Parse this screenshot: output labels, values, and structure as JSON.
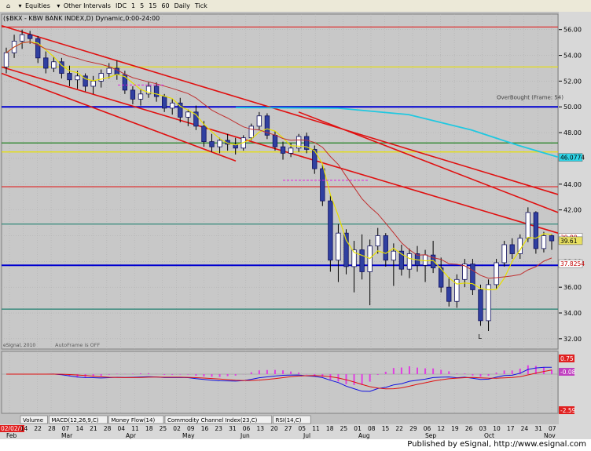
{
  "toolbar": {
    "items": [
      {
        "name": "home-icon",
        "label": ""
      },
      {
        "name": "equities-dropdown",
        "label": "Equities"
      },
      {
        "name": "other-intervals-dropdown",
        "label": "Other Intervals"
      },
      {
        "name": "idc-button",
        "label": "IDC"
      },
      {
        "name": "interval-1",
        "label": "1"
      },
      {
        "name": "interval-5",
        "label": "5"
      },
      {
        "name": "interval-15",
        "label": "15"
      },
      {
        "name": "interval-60",
        "label": "60"
      },
      {
        "name": "daily-button",
        "label": "Daily"
      },
      {
        "name": "tick-button",
        "label": "Tick"
      }
    ]
  },
  "chart_data": {
    "type": "candlestick",
    "title": "($BKX - KBW BANK INDEX,D) Dynamic,0:00-24:00",
    "ylim": [
      31.2,
      57.2
    ],
    "y_ticks": [
      "56.00",
      "54.00",
      "52.00",
      "50.00",
      "48.00",
      "46.00",
      "44.00",
      "42.00",
      "40.00",
      "38.00",
      "36.00",
      "34.00",
      "32.00"
    ],
    "x_ticks": [
      "02/02/11",
      "14",
      "22",
      "28",
      "07",
      "14",
      "21",
      "28",
      "04",
      "11",
      "18",
      "25",
      "02",
      "09",
      "16",
      "23",
      "31",
      "06",
      "13",
      "20",
      "27",
      "05",
      "11",
      "18",
      "25",
      "01",
      "08",
      "15",
      "22",
      "29",
      "06",
      "12",
      "19",
      "26",
      "03",
      "10",
      "17",
      "24",
      "31",
      "07"
    ],
    "month_labels": [
      "Feb",
      "Mar",
      "Apr",
      "May",
      "Jun",
      "Jul",
      "Aug",
      "Sep",
      "Oct",
      "Nov"
    ],
    "price_labels": [
      {
        "text": "56.00"
      },
      {
        "text": "54.00"
      },
      {
        "text": "52.00"
      },
      {
        "text": "50.00"
      },
      {
        "text": "48.00"
      },
      {
        "text": "46.00"
      },
      {
        "text": "44.00"
      },
      {
        "text": "42.00"
      },
      {
        "text": "40.00"
      },
      {
        "text": "38.00"
      },
      {
        "text": "36.00"
      },
      {
        "text": "34.00"
      },
      {
        "text": "32.00"
      }
    ],
    "value_badges": [
      {
        "text": "46.0774",
        "value": 46.08,
        "color": "#2fd6e8"
      },
      {
        "text": "39.88",
        "value": 39.88,
        "color": "#ffffff"
      },
      {
        "text": "39.61",
        "value": 39.61,
        "color": "#e8e060"
      },
      {
        "text": "37.8254",
        "value": 37.83,
        "color": "#ffffff"
      }
    ],
    "horizontal_lines": [
      {
        "value": 56.2,
        "color": "#e02020"
      },
      {
        "value": 53.1,
        "color": "#e8e000"
      },
      {
        "value": 50.0,
        "color": "#0000d0"
      },
      {
        "value": 47.2,
        "color": "#208020"
      },
      {
        "value": 46.5,
        "color": "#e8e000"
      },
      {
        "value": 43.8,
        "color": "#e02020"
      },
      {
        "value": 40.9,
        "color": "#208070"
      },
      {
        "value": 37.7,
        "color": "#0000d0"
      },
      {
        "value": 34.3,
        "color": "#208070"
      }
    ],
    "annotations": {
      "overbought": "OverBought (Frame: 54)",
      "autoframe": "AutoFrame is OFF",
      "esignal": "eSignal, 2010",
      "low_marker": "L"
    },
    "candles": [
      [
        53.1,
        54.6,
        52.6,
        54.2
      ],
      [
        54.2,
        55.6,
        53.8,
        55.1
      ],
      [
        55.1,
        56.0,
        54.5,
        55.6
      ],
      [
        55.6,
        55.9,
        54.9,
        55.3
      ],
      [
        55.3,
        55.5,
        53.4,
        53.8
      ],
      [
        53.8,
        54.3,
        52.6,
        53.0
      ],
      [
        53.0,
        53.9,
        52.7,
        53.5
      ],
      [
        53.5,
        53.8,
        52.2,
        52.6
      ],
      [
        52.6,
        53.2,
        51.6,
        52.1
      ],
      [
        52.1,
        52.8,
        51.4,
        52.4
      ],
      [
        52.4,
        52.6,
        51.2,
        51.6
      ],
      [
        51.6,
        52.4,
        51.0,
        52.0
      ],
      [
        52.0,
        52.9,
        51.5,
        52.6
      ],
      [
        52.6,
        53.4,
        52.2,
        53.0
      ],
      [
        53.0,
        53.6,
        52.1,
        52.5
      ],
      [
        52.5,
        52.8,
        51.0,
        51.3
      ],
      [
        51.3,
        51.6,
        50.2,
        50.6
      ],
      [
        50.6,
        51.4,
        50.1,
        51.0
      ],
      [
        51.0,
        51.9,
        50.7,
        51.6
      ],
      [
        51.6,
        51.9,
        50.4,
        50.8
      ],
      [
        50.8,
        51.0,
        49.6,
        49.9
      ],
      [
        49.9,
        50.6,
        49.4,
        50.3
      ],
      [
        50.3,
        50.7,
        48.8,
        49.2
      ],
      [
        49.2,
        49.8,
        48.5,
        49.6
      ],
      [
        49.6,
        50.1,
        48.2,
        48.5
      ],
      [
        48.5,
        48.9,
        46.9,
        47.3
      ],
      [
        47.3,
        47.9,
        46.5,
        46.9
      ],
      [
        46.9,
        47.6,
        46.4,
        47.4
      ],
      [
        47.4,
        47.9,
        46.6,
        47.1
      ],
      [
        47.1,
        47.6,
        46.3,
        46.8
      ],
      [
        46.8,
        47.8,
        46.6,
        47.6
      ],
      [
        47.6,
        48.7,
        47.4,
        48.5
      ],
      [
        48.5,
        49.6,
        48.2,
        49.3
      ],
      [
        49.3,
        49.5,
        47.5,
        47.8
      ],
      [
        47.8,
        48.1,
        46.6,
        46.9
      ],
      [
        46.9,
        47.3,
        45.9,
        46.4
      ],
      [
        46.4,
        47.2,
        46.1,
        46.8
      ],
      [
        46.8,
        47.9,
        46.5,
        47.7
      ],
      [
        47.7,
        48.0,
        46.4,
        46.7
      ],
      [
        46.7,
        47.0,
        44.8,
        45.2
      ],
      [
        45.2,
        45.5,
        42.3,
        42.7
      ],
      [
        42.7,
        43.1,
        37.2,
        38.1
      ],
      [
        38.1,
        40.9,
        36.4,
        40.2
      ],
      [
        40.2,
        40.5,
        37.0,
        37.6
      ],
      [
        37.6,
        39.6,
        35.6,
        38.9
      ],
      [
        38.9,
        40.1,
        36.6,
        37.2
      ],
      [
        37.2,
        39.7,
        34.6,
        39.2
      ],
      [
        39.2,
        40.6,
        38.6,
        40.0
      ],
      [
        40.0,
        40.2,
        37.6,
        38.1
      ],
      [
        38.1,
        39.4,
        36.1,
        38.8
      ],
      [
        38.8,
        39.3,
        36.9,
        37.4
      ],
      [
        37.4,
        39.0,
        36.7,
        38.6
      ],
      [
        38.6,
        39.2,
        37.2,
        37.7
      ],
      [
        37.7,
        38.9,
        36.4,
        38.5
      ],
      [
        38.5,
        39.6,
        37.1,
        37.5
      ],
      [
        37.5,
        38.3,
        35.6,
        36.0
      ],
      [
        36.0,
        36.8,
        34.5,
        34.9
      ],
      [
        34.9,
        37.0,
        34.4,
        36.6
      ],
      [
        36.6,
        38.2,
        36.0,
        37.8
      ],
      [
        37.8,
        38.2,
        35.4,
        35.8
      ],
      [
        35.8,
        36.2,
        33.0,
        33.4
      ],
      [
        33.4,
        36.6,
        32.6,
        36.2
      ],
      [
        36.2,
        38.2,
        35.9,
        37.9
      ],
      [
        37.9,
        39.6,
        37.6,
        39.3
      ],
      [
        39.3,
        39.8,
        38.2,
        38.6
      ],
      [
        38.6,
        40.1,
        38.2,
        39.8
      ],
      [
        39.8,
        42.2,
        39.5,
        41.8
      ],
      [
        41.8,
        41.9,
        38.6,
        39.0
      ],
      [
        39.0,
        40.3,
        38.7,
        40.0
      ],
      [
        40.0,
        40.1,
        38.9,
        39.6
      ]
    ]
  },
  "tabs": [
    {
      "label": "Volume"
    },
    {
      "label": "MACD(12,26,9,C)"
    },
    {
      "label": "Money Flow(14)"
    },
    {
      "label": "Commodity Channel Index(23,C)"
    },
    {
      "label": "RSI(14,C)"
    }
  ],
  "macd": {
    "badges": [
      {
        "text": "0.75",
        "color": "#e02020"
      },
      {
        "text": "-0.08",
        "color": "#c040c0"
      },
      {
        "text": "-2.59",
        "color": "#e02020"
      }
    ]
  },
  "footer": {
    "text": "Published by eSignal, http://www.esignal.com"
  }
}
